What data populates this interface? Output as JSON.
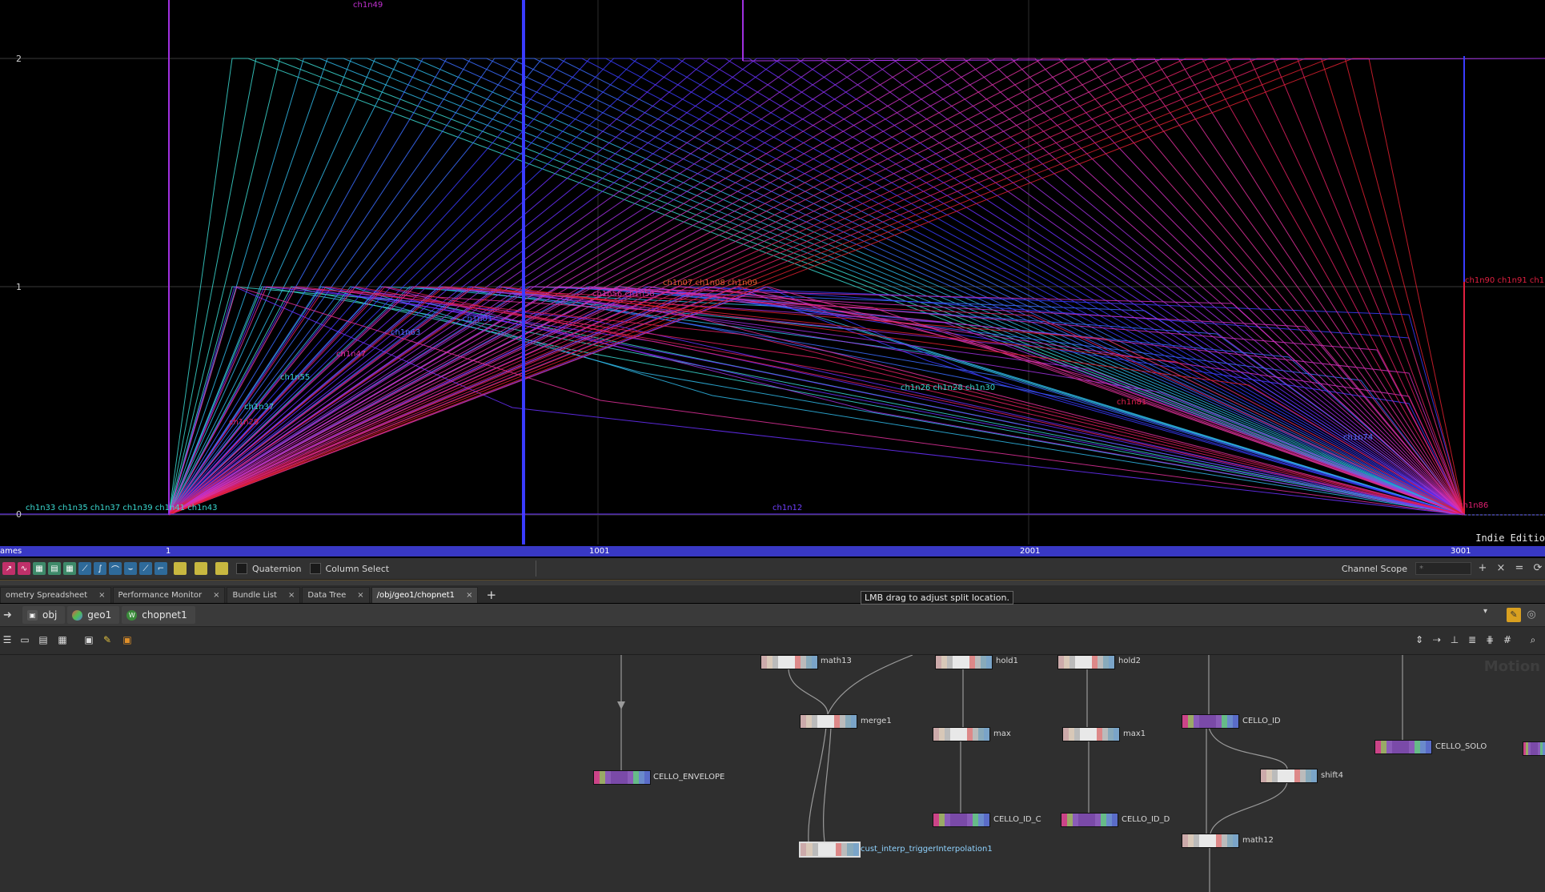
{
  "graph": {
    "y_ticks": [
      "2",
      "1",
      "0"
    ],
    "edition": "Indie Editio",
    "channel_labels": [
      {
        "text": "ch1n49",
        "color": "#c030d0"
      },
      {
        "text": "ch1n12",
        "color": "#7040ff"
      },
      {
        "text": "ch1n01",
        "color": "#4060ff"
      },
      {
        "text": "ch1n37",
        "color": "#3ad8d0"
      },
      {
        "text": "ch1n74",
        "color": "#5070ff"
      },
      {
        "text": "ch1n86",
        "color": "#e02070"
      },
      {
        "text": "ch1n33 ch1n35 ch1n37 ch1n39 ch1n41 ch1n43",
        "color": "#3ad8d0"
      },
      {
        "text": "ch1n90 ch1n91 ch1n92 ch1n93",
        "color": "#e02040"
      },
      {
        "text": "ch1n07 ch1n08 ch1n09",
        "color": "#e06030"
      },
      {
        "text": "ch1n26 ch1n28 ch1n30",
        "color": "#3ad8d0"
      },
      {
        "text": "ch1n56 ch1n58",
        "color": "#d030a0"
      },
      {
        "text": "ch1n81",
        "color": "#e02050"
      },
      {
        "text": "ch1n55",
        "color": "#3ad8d0"
      },
      {
        "text": "ch1n47",
        "color": "#e030a0"
      },
      {
        "text": "ch1n63",
        "color": "#5070ff"
      },
      {
        "text": "ch1n29",
        "color": "#e02050"
      }
    ]
  },
  "ruler": {
    "start_label": "ames",
    "ticks": [
      "1",
      "1001",
      "2001",
      "3001"
    ]
  },
  "chan_toolbar": {
    "quaternion_label": "Quaternion",
    "column_select_label": "Column Select",
    "channel_scope_label": "Channel Scope",
    "channel_scope_value": "*"
  },
  "tooltip": "LMB drag to adjust split location.",
  "tabs": [
    {
      "label": "ometry Spreadsheet",
      "active": false
    },
    {
      "label": "Performance Monitor",
      "active": false
    },
    {
      "label": "Bundle List",
      "active": false
    },
    {
      "label": "Data Tree",
      "active": false
    },
    {
      "label": "/obj/geo1/chopnet1",
      "active": true
    }
  ],
  "pathbar": {
    "crumbs": [
      "obj",
      "geo1",
      "chopnet1"
    ]
  },
  "network": {
    "watermark": "Motion",
    "nodes": [
      {
        "id": "math13",
        "label": "math13",
        "color": "light",
        "selected": false
      },
      {
        "id": "hold1",
        "label": "hold1",
        "color": "light",
        "selected": false
      },
      {
        "id": "hold2",
        "label": "hold2",
        "color": "light",
        "selected": false
      },
      {
        "id": "merge1",
        "label": "merge1",
        "color": "light",
        "selected": false
      },
      {
        "id": "max",
        "label": "max",
        "color": "light",
        "selected": false
      },
      {
        "id": "max1",
        "label": "max1",
        "color": "light",
        "selected": false
      },
      {
        "id": "CELLO_ID",
        "label": "CELLO_ID",
        "color": "purple",
        "selected": false
      },
      {
        "id": "CELLO_SOLO",
        "label": "CELLO_SOLO",
        "color": "purple",
        "selected": false
      },
      {
        "id": "CELLO_ENVELOPE",
        "label": "CELLO_ENVELOPE",
        "color": "purple",
        "selected": false
      },
      {
        "id": "shift4",
        "label": "shift4",
        "color": "light",
        "selected": false
      },
      {
        "id": "CELLO_ID_C",
        "label": "CELLO_ID_C",
        "color": "purple",
        "selected": false
      },
      {
        "id": "CELLO_ID_D",
        "label": "CELLO_ID_D",
        "color": "purple",
        "selected": false
      },
      {
        "id": "cust",
        "label": "cust_interp_triggerInterpolation1",
        "color": "light",
        "selected": true
      },
      {
        "id": "math12",
        "label": "math12",
        "color": "light",
        "selected": false
      }
    ]
  },
  "colors": {
    "ruler": "#3838c4",
    "cyan": "#3ad8d0",
    "blue": "#3a50ff",
    "magenta": "#d030c0",
    "red": "#e02040",
    "purple_node": "#7a4aa8"
  }
}
